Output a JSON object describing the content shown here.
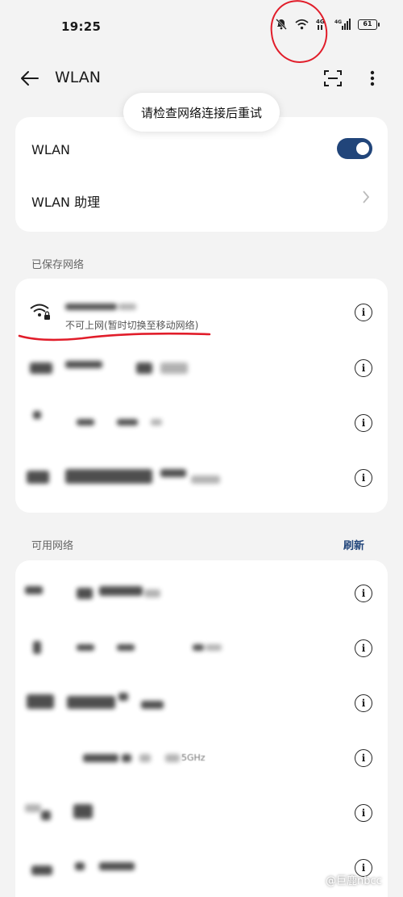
{
  "status_bar": {
    "time": "19:25",
    "battery": "61",
    "icons": [
      "mute-bell-icon",
      "wifi-icon",
      "signal-4g-icon",
      "signal-4g-icon-2"
    ]
  },
  "header": {
    "title": "WLAN",
    "back_icon": "back-arrow-icon",
    "scan_icon": "scan-icon",
    "more_icon": "more-vertical-icon"
  },
  "toast": {
    "text": "请检查网络连接后重试"
  },
  "settings": {
    "wlan_label": "WLAN",
    "wlan_enabled": true,
    "assistant_label": "WLAN 助理"
  },
  "saved_networks": {
    "title": "已保存网络",
    "items": [
      {
        "status": "不可上网(暂时切换至移动网络)"
      },
      {
        "status": ""
      },
      {
        "status": ""
      },
      {
        "status": ""
      }
    ]
  },
  "available_networks": {
    "title": "可用网络",
    "refresh_label": "刷新",
    "items": [
      {
        "label": ""
      },
      {
        "label": ""
      },
      {
        "label": ""
      },
      {
        "label": "5GHz"
      },
      {
        "label": ""
      },
      {
        "label": ""
      }
    ]
  },
  "watermark": {
    "text": "@巨鹿nbcc"
  },
  "colors": {
    "accent": "#21457a",
    "annotation": "#e11d2a",
    "background": "#f3f3f3"
  }
}
